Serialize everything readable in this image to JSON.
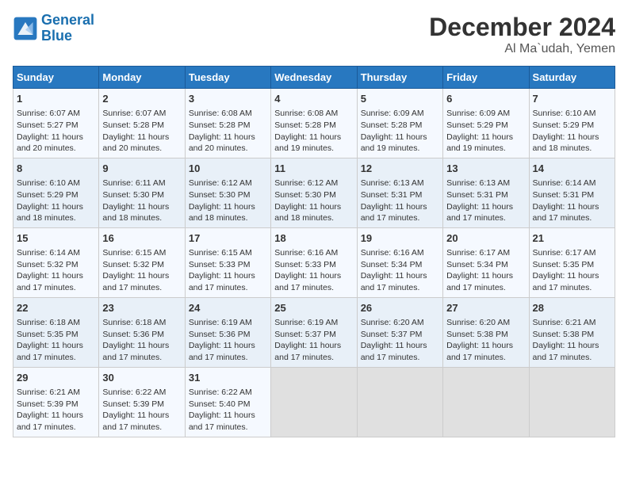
{
  "header": {
    "logo_line1": "General",
    "logo_line2": "Blue",
    "month": "December 2024",
    "location": "Al Ma`udah, Yemen"
  },
  "days_of_week": [
    "Sunday",
    "Monday",
    "Tuesday",
    "Wednesday",
    "Thursday",
    "Friday",
    "Saturday"
  ],
  "weeks": [
    [
      {
        "day": "1",
        "lines": [
          "Sunrise: 6:07 AM",
          "Sunset: 5:27 PM",
          "Daylight: 11 hours",
          "and 20 minutes."
        ]
      },
      {
        "day": "2",
        "lines": [
          "Sunrise: 6:07 AM",
          "Sunset: 5:28 PM",
          "Daylight: 11 hours",
          "and 20 minutes."
        ]
      },
      {
        "day": "3",
        "lines": [
          "Sunrise: 6:08 AM",
          "Sunset: 5:28 PM",
          "Daylight: 11 hours",
          "and 20 minutes."
        ]
      },
      {
        "day": "4",
        "lines": [
          "Sunrise: 6:08 AM",
          "Sunset: 5:28 PM",
          "Daylight: 11 hours",
          "and 19 minutes."
        ]
      },
      {
        "day": "5",
        "lines": [
          "Sunrise: 6:09 AM",
          "Sunset: 5:28 PM",
          "Daylight: 11 hours",
          "and 19 minutes."
        ]
      },
      {
        "day": "6",
        "lines": [
          "Sunrise: 6:09 AM",
          "Sunset: 5:29 PM",
          "Daylight: 11 hours",
          "and 19 minutes."
        ]
      },
      {
        "day": "7",
        "lines": [
          "Sunrise: 6:10 AM",
          "Sunset: 5:29 PM",
          "Daylight: 11 hours",
          "and 18 minutes."
        ]
      }
    ],
    [
      {
        "day": "8",
        "lines": [
          "Sunrise: 6:10 AM",
          "Sunset: 5:29 PM",
          "Daylight: 11 hours",
          "and 18 minutes."
        ]
      },
      {
        "day": "9",
        "lines": [
          "Sunrise: 6:11 AM",
          "Sunset: 5:30 PM",
          "Daylight: 11 hours",
          "and 18 minutes."
        ]
      },
      {
        "day": "10",
        "lines": [
          "Sunrise: 6:12 AM",
          "Sunset: 5:30 PM",
          "Daylight: 11 hours",
          "and 18 minutes."
        ]
      },
      {
        "day": "11",
        "lines": [
          "Sunrise: 6:12 AM",
          "Sunset: 5:30 PM",
          "Daylight: 11 hours",
          "and 18 minutes."
        ]
      },
      {
        "day": "12",
        "lines": [
          "Sunrise: 6:13 AM",
          "Sunset: 5:31 PM",
          "Daylight: 11 hours",
          "and 17 minutes."
        ]
      },
      {
        "day": "13",
        "lines": [
          "Sunrise: 6:13 AM",
          "Sunset: 5:31 PM",
          "Daylight: 11 hours",
          "and 17 minutes."
        ]
      },
      {
        "day": "14",
        "lines": [
          "Sunrise: 6:14 AM",
          "Sunset: 5:31 PM",
          "Daylight: 11 hours",
          "and 17 minutes."
        ]
      }
    ],
    [
      {
        "day": "15",
        "lines": [
          "Sunrise: 6:14 AM",
          "Sunset: 5:32 PM",
          "Daylight: 11 hours",
          "and 17 minutes."
        ]
      },
      {
        "day": "16",
        "lines": [
          "Sunrise: 6:15 AM",
          "Sunset: 5:32 PM",
          "Daylight: 11 hours",
          "and 17 minutes."
        ]
      },
      {
        "day": "17",
        "lines": [
          "Sunrise: 6:15 AM",
          "Sunset: 5:33 PM",
          "Daylight: 11 hours",
          "and 17 minutes."
        ]
      },
      {
        "day": "18",
        "lines": [
          "Sunrise: 6:16 AM",
          "Sunset: 5:33 PM",
          "Daylight: 11 hours",
          "and 17 minutes."
        ]
      },
      {
        "day": "19",
        "lines": [
          "Sunrise: 6:16 AM",
          "Sunset: 5:34 PM",
          "Daylight: 11 hours",
          "and 17 minutes."
        ]
      },
      {
        "day": "20",
        "lines": [
          "Sunrise: 6:17 AM",
          "Sunset: 5:34 PM",
          "Daylight: 11 hours",
          "and 17 minutes."
        ]
      },
      {
        "day": "21",
        "lines": [
          "Sunrise: 6:17 AM",
          "Sunset: 5:35 PM",
          "Daylight: 11 hours",
          "and 17 minutes."
        ]
      }
    ],
    [
      {
        "day": "22",
        "lines": [
          "Sunrise: 6:18 AM",
          "Sunset: 5:35 PM",
          "Daylight: 11 hours",
          "and 17 minutes."
        ]
      },
      {
        "day": "23",
        "lines": [
          "Sunrise: 6:18 AM",
          "Sunset: 5:36 PM",
          "Daylight: 11 hours",
          "and 17 minutes."
        ]
      },
      {
        "day": "24",
        "lines": [
          "Sunrise: 6:19 AM",
          "Sunset: 5:36 PM",
          "Daylight: 11 hours",
          "and 17 minutes."
        ]
      },
      {
        "day": "25",
        "lines": [
          "Sunrise: 6:19 AM",
          "Sunset: 5:37 PM",
          "Daylight: 11 hours",
          "and 17 minutes."
        ]
      },
      {
        "day": "26",
        "lines": [
          "Sunrise: 6:20 AM",
          "Sunset: 5:37 PM",
          "Daylight: 11 hours",
          "and 17 minutes."
        ]
      },
      {
        "day": "27",
        "lines": [
          "Sunrise: 6:20 AM",
          "Sunset: 5:38 PM",
          "Daylight: 11 hours",
          "and 17 minutes."
        ]
      },
      {
        "day": "28",
        "lines": [
          "Sunrise: 6:21 AM",
          "Sunset: 5:38 PM",
          "Daylight: 11 hours",
          "and 17 minutes."
        ]
      }
    ],
    [
      {
        "day": "29",
        "lines": [
          "Sunrise: 6:21 AM",
          "Sunset: 5:39 PM",
          "Daylight: 11 hours",
          "and 17 minutes."
        ]
      },
      {
        "day": "30",
        "lines": [
          "Sunrise: 6:22 AM",
          "Sunset: 5:39 PM",
          "Daylight: 11 hours",
          "and 17 minutes."
        ]
      },
      {
        "day": "31",
        "lines": [
          "Sunrise: 6:22 AM",
          "Sunset: 5:40 PM",
          "Daylight: 11 hours",
          "and 17 minutes."
        ]
      },
      null,
      null,
      null,
      null
    ]
  ]
}
